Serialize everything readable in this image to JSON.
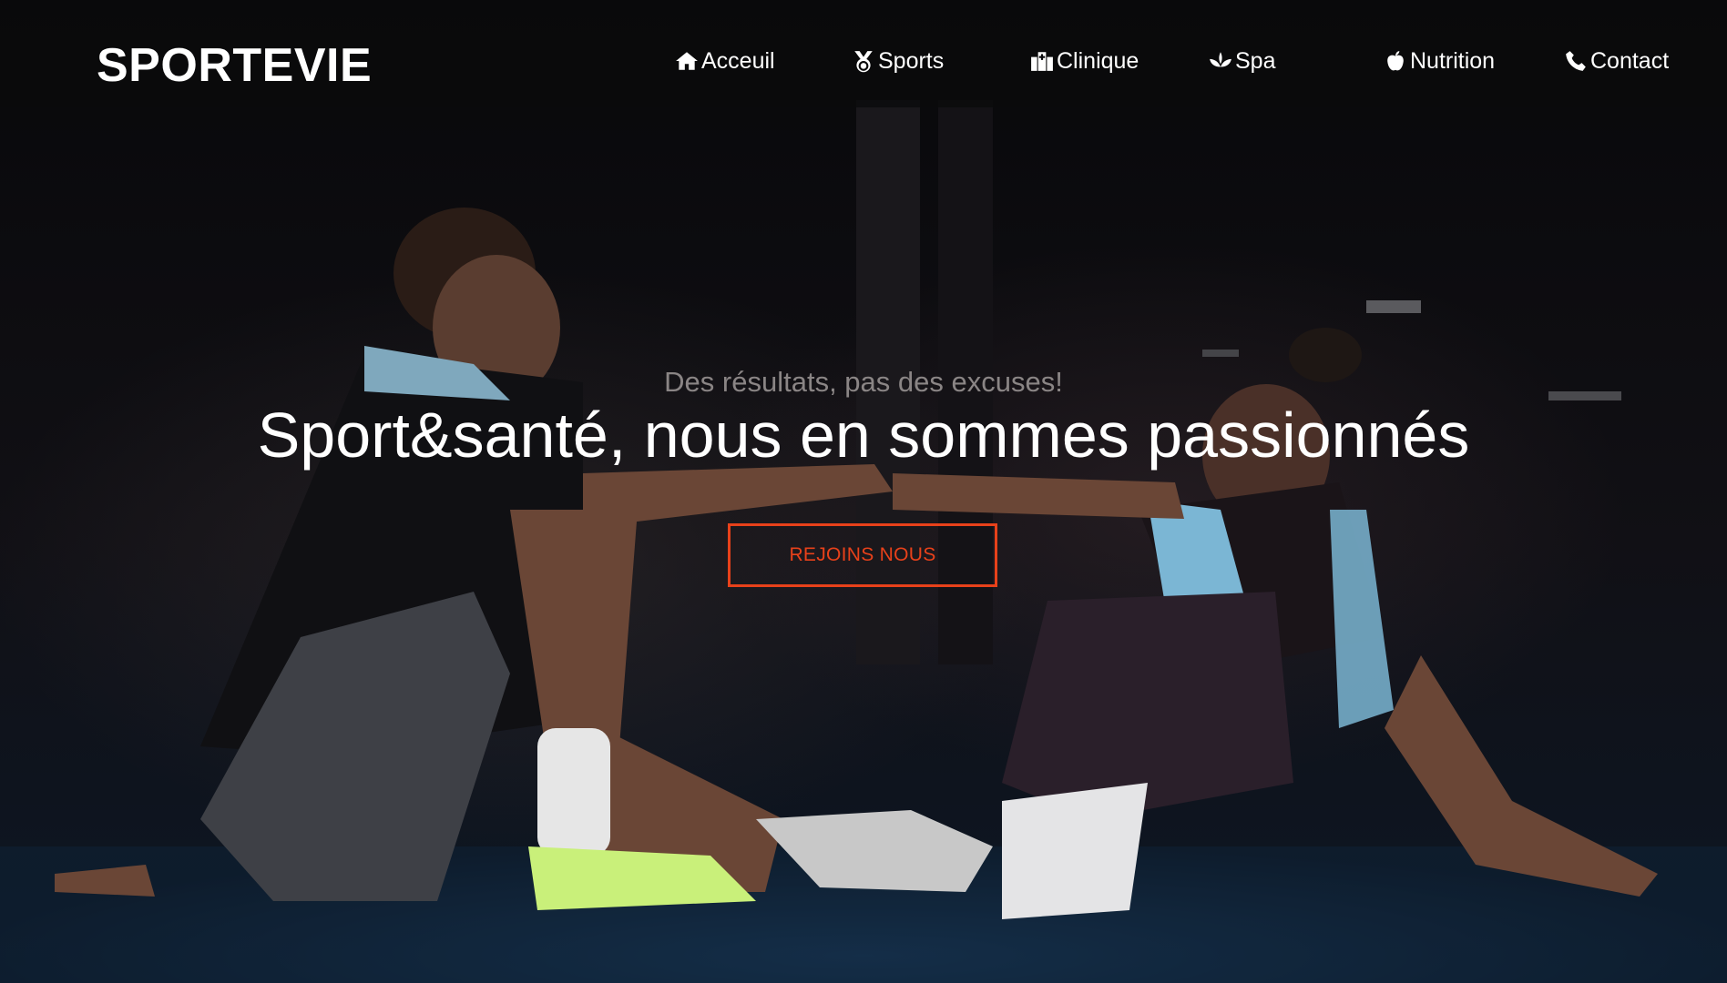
{
  "brand": {
    "logo_text": "SPORTEVIE"
  },
  "nav": {
    "items": [
      {
        "label": "Acceuil",
        "icon": "home-icon"
      },
      {
        "label": "Sports",
        "icon": "medal-icon"
      },
      {
        "label": "Clinique",
        "icon": "hospital-icon"
      },
      {
        "label": "Spa",
        "icon": "lotus-icon"
      },
      {
        "label": "Nutrition",
        "icon": "apple-icon"
      },
      {
        "label": "Contact",
        "icon": "phone-icon"
      }
    ]
  },
  "hero": {
    "tagline": "Des résultats, pas des excuses!",
    "headline": "Sport&santé, nous en sommes passionnés",
    "cta_label": "REJOINS NOUS",
    "background_image": "two-athletes-high-five-gym-photo"
  },
  "colors": {
    "accent": "#e8411a",
    "navbar_bg": "#0a0a0c",
    "text_primary": "#ffffff",
    "tagline": "#8a8585"
  }
}
